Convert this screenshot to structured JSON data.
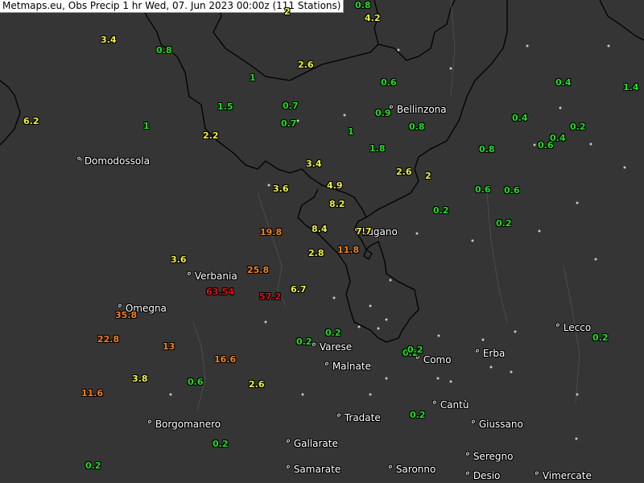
{
  "title": "Metmaps.eu, Obs Precip 1 hr Wed, 07. Jun 2023 00:00z (111 Stations)",
  "colors": {
    "background": "#353535",
    "border": "#000000",
    "dot": "#c8c8c8",
    "green": "#22dd22",
    "yellow": "#f0f040",
    "orange": "#f08020",
    "red": "#dd1010"
  },
  "cities": [
    {
      "name": "Domodossola"
    },
    {
      "name": "Bellinzona"
    },
    {
      "name": "Lugano"
    },
    {
      "name": "Verbania"
    },
    {
      "name": "Omegna"
    },
    {
      "name": "Varese"
    },
    {
      "name": "Malnate"
    },
    {
      "name": "Como"
    },
    {
      "name": "Erba"
    },
    {
      "name": "Lecco"
    },
    {
      "name": "Cantù"
    },
    {
      "name": "Tradate"
    },
    {
      "name": "Borgomanero"
    },
    {
      "name": "Giussano"
    },
    {
      "name": "Gallarate"
    },
    {
      "name": "Seregno"
    },
    {
      "name": "Samarate"
    },
    {
      "name": "Saronno"
    },
    {
      "name": "Desio"
    },
    {
      "name": "Vimercate"
    }
  ],
  "values": [
    {
      "v": "0.8",
      "c": "green"
    },
    {
      "v": "4.2",
      "c": "yellow"
    },
    {
      "v": "2",
      "c": "yellow"
    },
    {
      "v": "3.4",
      "c": "yellow"
    },
    {
      "v": "0.8",
      "c": "green"
    },
    {
      "v": "2.6",
      "c": "yellow"
    },
    {
      "v": "1",
      "c": "green"
    },
    {
      "v": "0.6",
      "c": "green"
    },
    {
      "v": "0.4",
      "c": "green"
    },
    {
      "v": "1.4",
      "c": "green"
    },
    {
      "v": "1.5",
      "c": "green"
    },
    {
      "v": "0.7",
      "c": "green"
    },
    {
      "v": "0.9",
      "c": "green"
    },
    {
      "v": "6.2",
      "c": "yellow"
    },
    {
      "v": "1",
      "c": "green"
    },
    {
      "v": "0.7",
      "c": "green"
    },
    {
      "v": "0.8",
      "c": "green"
    },
    {
      "v": "0.4",
      "c": "green"
    },
    {
      "v": "0.2",
      "c": "green"
    },
    {
      "v": "2.2",
      "c": "yellow"
    },
    {
      "v": "1",
      "c": "green"
    },
    {
      "v": "0.4",
      "c": "green"
    },
    {
      "v": "0.6",
      "c": "green"
    },
    {
      "v": "1.8",
      "c": "green"
    },
    {
      "v": "0.8",
      "c": "green"
    },
    {
      "v": "3.4",
      "c": "yellow"
    },
    {
      "v": "2.6",
      "c": "yellow"
    },
    {
      "v": "2",
      "c": "yellow"
    },
    {
      "v": "3.6",
      "c": "yellow"
    },
    {
      "v": "4.9",
      "c": "yellow"
    },
    {
      "v": "0.6",
      "c": "green"
    },
    {
      "v": "0.6",
      "c": "green"
    },
    {
      "v": "8.2",
      "c": "yellow"
    },
    {
      "v": "0.2",
      "c": "green"
    },
    {
      "v": "0.2",
      "c": "green"
    },
    {
      "v": "19.8",
      "c": "orange"
    },
    {
      "v": "8.4",
      "c": "yellow"
    },
    {
      "v": "7.7",
      "c": "yellow"
    },
    {
      "v": "3.6",
      "c": "yellow"
    },
    {
      "v": "2.8",
      "c": "yellow"
    },
    {
      "v": "11.8",
      "c": "orange"
    },
    {
      "v": "25.8",
      "c": "orange"
    },
    {
      "v": "63.54",
      "c": "red"
    },
    {
      "v": "6.7",
      "c": "yellow"
    },
    {
      "v": "57.2",
      "c": "red"
    },
    {
      "v": "35.8",
      "c": "orange"
    },
    {
      "v": "0.2",
      "c": "green"
    },
    {
      "v": "22.8",
      "c": "orange"
    },
    {
      "v": "0.2",
      "c": "green"
    },
    {
      "v": "13",
      "c": "orange"
    },
    {
      "v": "0.2",
      "c": "green"
    },
    {
      "v": "0.2",
      "c": "green"
    },
    {
      "v": "16.6",
      "c": "orange"
    },
    {
      "v": "0.2",
      "c": "green"
    },
    {
      "v": "3.8",
      "c": "yellow"
    },
    {
      "v": "0.6",
      "c": "green"
    },
    {
      "v": "2.6",
      "c": "yellow"
    },
    {
      "v": "11.6",
      "c": "orange"
    },
    {
      "v": "0.2",
      "c": "green"
    },
    {
      "v": "0.2",
      "c": "green"
    },
    {
      "v": "0.2",
      "c": "green"
    }
  ]
}
